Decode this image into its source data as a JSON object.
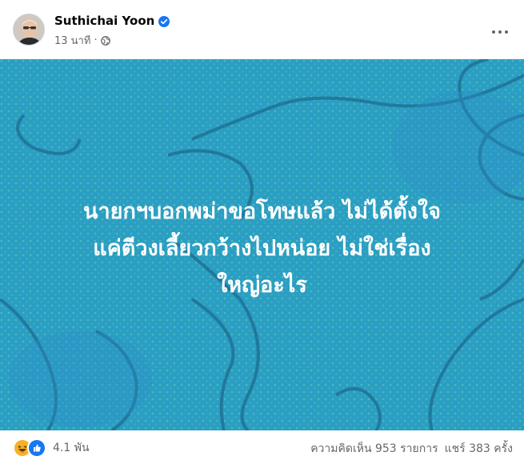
{
  "post": {
    "author": "Suthichai Yoon",
    "verified_icon": "verified-badge-icon",
    "time": "13 นาที",
    "separator": "·",
    "privacy_icon": "globe-icon",
    "more_icon": "more-horizontal-icon",
    "text": "นายกฯบอกพม่าขอโทษแล้ว ไม่ได้ตั้งใจ\nแค่ตีวงเลี้ยวกว้างไปหน่อย ไม่ใช่เรื่อง\nใหญ่อะไร",
    "background_color": "#2a9ec3"
  },
  "footer": {
    "reaction_icons": [
      "haha-icon",
      "like-icon"
    ],
    "reaction_count": "4.1 พัน",
    "comments": "ความคิดเห็น 953 รายการ",
    "shares": "แชร์ 383 ครั้ง"
  },
  "colors": {
    "brand_blue": "#1877f2",
    "secondary_text": "#65676b",
    "haha_yellow": "#f7b125"
  }
}
